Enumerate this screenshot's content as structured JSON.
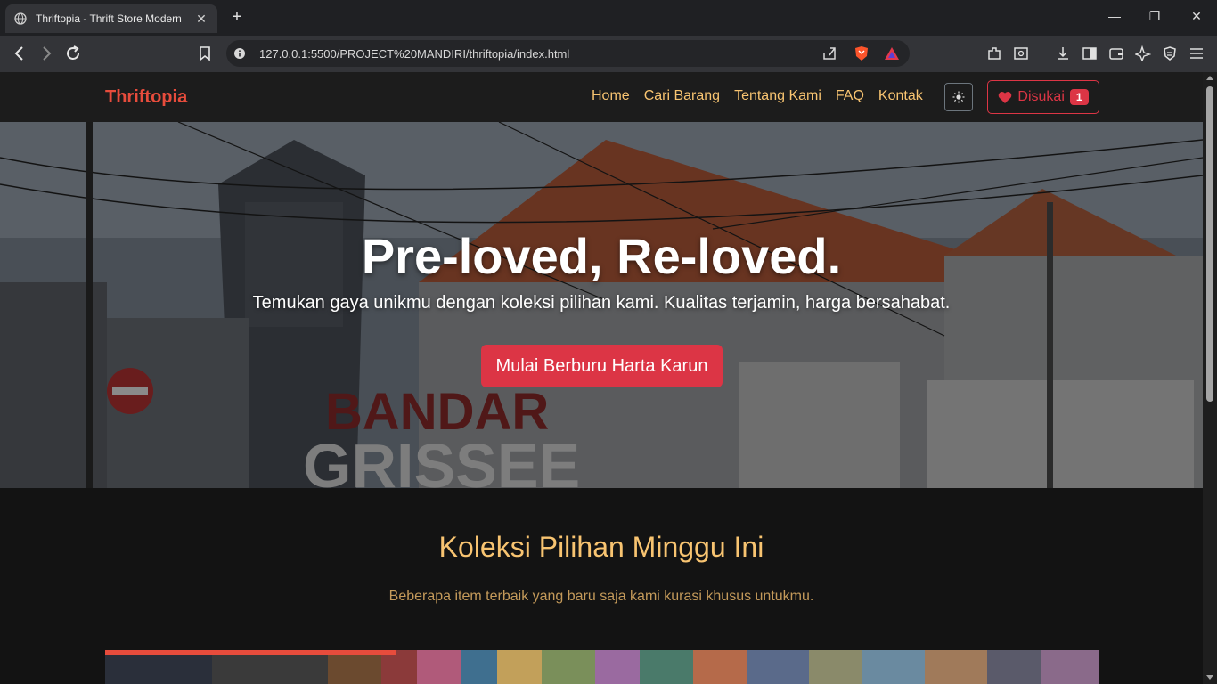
{
  "browser": {
    "tab_title": "Thriftopia - Thrift Store Modern",
    "url": "127.0.0.1:5500/PROJECT%20MANDIRI/thriftopia/index.html"
  },
  "navbar": {
    "brand": "Thriftopia",
    "links": [
      "Home",
      "Cari Barang",
      "Tentang Kami",
      "FAQ",
      "Kontak"
    ],
    "theme_icon": "sun-icon",
    "favorites_label": "Disukai",
    "favorites_count": "1"
  },
  "hero": {
    "title": "Pre-loved, Re-loved.",
    "subtitle": "Temukan gaya unikmu dengan koleksi pilihan kami. Kualitas terjamin, harga bersahabat.",
    "cta": "Mulai Berburu Harta Karun"
  },
  "featured": {
    "title": "Koleksi Pilihan Minggu Ini",
    "subtitle": "Beberapa item terbaik yang baru saja kami kurasi khusus untukmu."
  },
  "colors": {
    "brand": "#e74c3c",
    "nav_link": "#f8c471",
    "primary_button": "#dc3545",
    "background": "#131313"
  }
}
